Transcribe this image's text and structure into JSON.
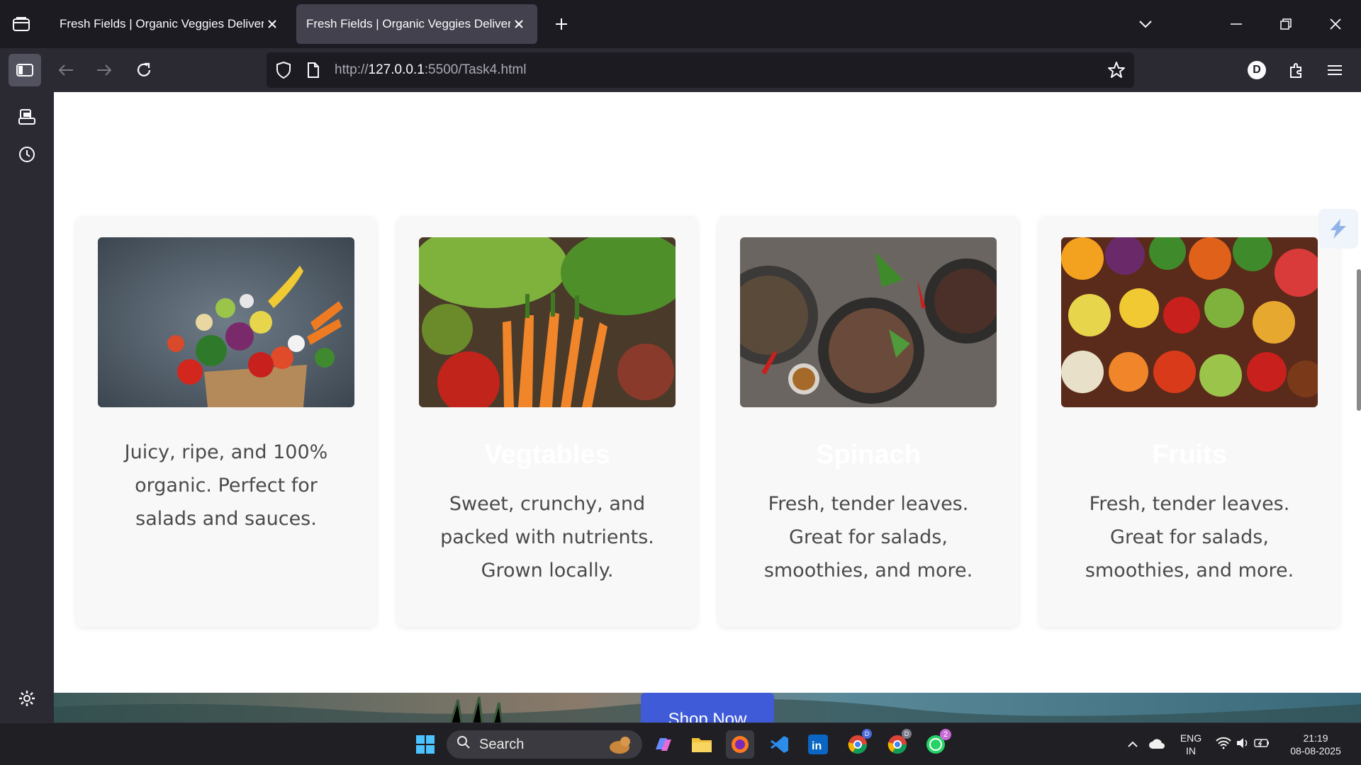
{
  "browser": {
    "tabs": [
      {
        "title": "Fresh Fields | Organic Veggies Delivered",
        "active": false
      },
      {
        "title": "Fresh Fields | Organic Veggies Delivered",
        "active": true
      }
    ],
    "url": {
      "scheme": "http://",
      "host": "127.0.0.1",
      "rest": ":5500/Task4.html"
    },
    "profile_initial": "D"
  },
  "page": {
    "cards": [
      {
        "image": "grocery-bag-vegetables-photo",
        "heading": "",
        "description": "Juicy, ripe, and 100% organic. Perfect for salads and sauces."
      },
      {
        "image": "market-vegetables-photo",
        "heading": "Vegtables",
        "description": "Sweet, crunchy, and packed with nutrients. Grown locally."
      },
      {
        "image": "plated-dishes-photo",
        "heading": "Spinach",
        "description": "Fresh, tender leaves. Great for salads, smoothies, and more."
      },
      {
        "image": "assorted-fruits-photo",
        "heading": "Fruits",
        "description": "Fresh, tender leaves. Great for salads, smoothies, and more."
      }
    ],
    "cta_label": "Shop Now"
  },
  "taskbar": {
    "search_label": "Search",
    "language": "ENG",
    "region": "IN",
    "time": "21:19",
    "date": "08-08-2025",
    "whatsapp_badge": "2",
    "chrome_profile_1": "D",
    "chrome_profile_2": "D"
  },
  "colors": {
    "accent": "#3f5bd8",
    "tab_active": "#42414d",
    "chrome_bg": "#1c1b22"
  }
}
